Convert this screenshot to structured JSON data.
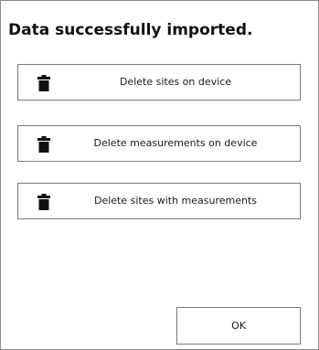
{
  "dialog": {
    "title": "Data successfully imported."
  },
  "actions": [
    {
      "label": "Delete sites on device",
      "icon": "trash-icon"
    },
    {
      "label": "Delete measurements on device",
      "icon": "trash-icon"
    },
    {
      "label": "Delete sites with measurements",
      "icon": "trash-icon"
    }
  ],
  "footer": {
    "ok_label": "OK"
  }
}
